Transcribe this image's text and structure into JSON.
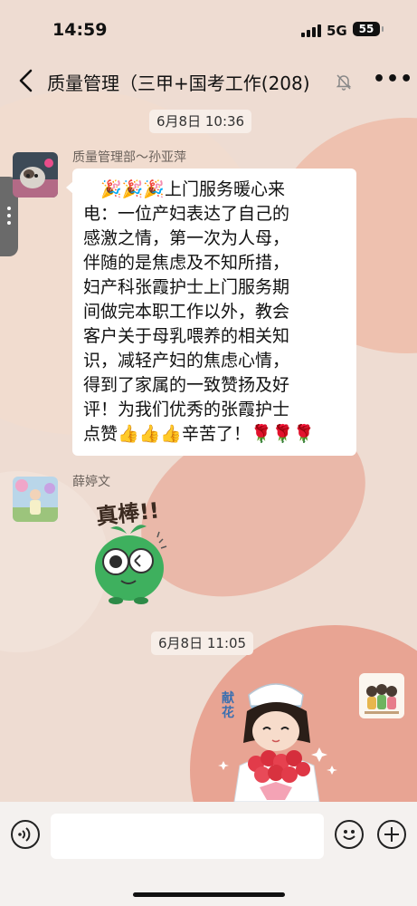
{
  "status_bar": {
    "time": "14:59",
    "network": "5G",
    "battery": "55"
  },
  "header": {
    "title": "质量管理（三甲+国考工作",
    "member_count": "(208)"
  },
  "messages": [
    {
      "timestamp": "6月8日 10:36",
      "sender": "质量管理部～孙亚萍",
      "text_lines": [
        "　🎉🎉🎉上门服务暖心来",
        "电：一位产妇表达了自己的",
        "感激之情，第一次为人母，",
        "伴随的是焦虑及不知所措，",
        "妇产科张霞护士上门服务期",
        "间做完本职工作以外，教会",
        "客户关于母乳喂养的相关知",
        "识，减轻产妇的焦虑心情，",
        "得到了家属的一致赞扬及好",
        "评！为我们优秀的张霞护士",
        "点赞👍👍👍辛苦了！🌹🌹🌹"
      ]
    },
    {
      "sender": "薛婷文",
      "sticker_text": "真棒!!"
    },
    {
      "timestamp": "6月8日 11:05",
      "sticker_text": "献花"
    }
  ],
  "colors": {
    "accent_pink": "#e58c78",
    "bubble": "#ffffff"
  }
}
